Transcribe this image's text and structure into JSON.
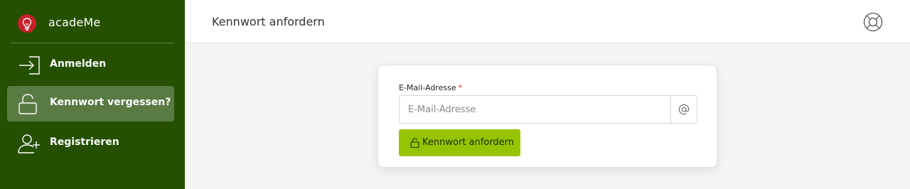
{
  "app": {
    "name": "acadeMe"
  },
  "sidebar": {
    "items": [
      {
        "label": "Anmelden",
        "icon": "login-icon",
        "active": false
      },
      {
        "label": "Kennwort vergessen?",
        "icon": "unlock-icon",
        "active": true
      },
      {
        "label": "Registrieren",
        "icon": "user-add-icon",
        "active": false
      }
    ]
  },
  "header": {
    "title": "Kennwort anfordern",
    "help_icon": "lifebuoy-icon"
  },
  "form": {
    "email_label": "E-Mail-Adresse",
    "required_mark": "*",
    "email_placeholder": "E-Mail-Adresse",
    "email_value": "",
    "addon_icon": "at-icon",
    "submit_label": "Kennwort anfordern",
    "submit_icon": "unlock-icon"
  },
  "colors": {
    "sidebar_bg": "#245000",
    "sidebar_active": "#5a7a44",
    "button_bg": "#97c400",
    "logo_red": "#c8202a",
    "required_red": "#d22f2f"
  }
}
